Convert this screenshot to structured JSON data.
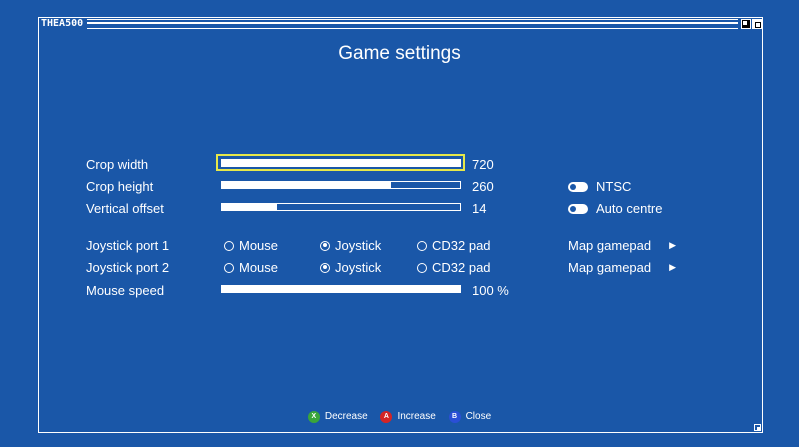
{
  "window": {
    "title": "THEA500"
  },
  "page": {
    "title": "Game settings"
  },
  "sliders": {
    "crop_width": {
      "label": "Crop width",
      "value": "720",
      "fill": 1.0
    },
    "crop_height": {
      "label": "Crop height",
      "value": "260",
      "fill": 0.71
    },
    "vertical_offset": {
      "label": "Vertical offset",
      "value": "14",
      "fill": 0.23
    },
    "mouse_speed": {
      "label": "Mouse speed",
      "value": "100 %",
      "fill": 1.0
    }
  },
  "toggles": {
    "ntsc": {
      "label": "NTSC",
      "on": true
    },
    "auto_centre": {
      "label": "Auto centre",
      "on": true
    }
  },
  "joystick": {
    "port1": {
      "label": "Joystick port 1",
      "selected": "Joystick"
    },
    "port2": {
      "label": "Joystick port 2",
      "selected": "Joystick"
    },
    "options": [
      "Mouse",
      "Joystick",
      "CD32 pad"
    ]
  },
  "map_gamepad": {
    "label": "Map gamepad"
  },
  "hints": {
    "decrease": {
      "key": "X",
      "label": "Decrease",
      "color": "#3aa53a"
    },
    "increase": {
      "key": "A",
      "label": "Increase",
      "color": "#d42525"
    },
    "close": {
      "key": "B",
      "label": "Close",
      "color": "#2a4fd6"
    }
  },
  "colors": {
    "background": "#1a57a8",
    "focus": "#e6e84a"
  }
}
